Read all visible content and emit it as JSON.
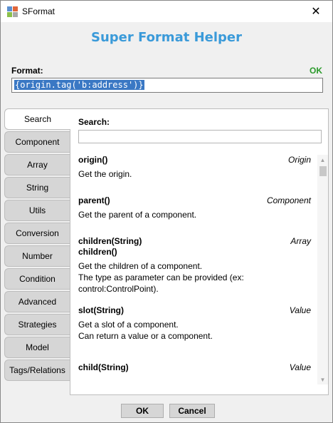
{
  "window": {
    "title": "SFormat",
    "close_glyph": "✕",
    "icon": "app-icon"
  },
  "header": {
    "title": "Super Format Helper"
  },
  "format": {
    "label": "Format:",
    "status": "OK",
    "value": "{origin.tag('b:address')}"
  },
  "tabs": [
    {
      "label": "Search",
      "active": true
    },
    {
      "label": "Component"
    },
    {
      "label": "Array"
    },
    {
      "label": "String"
    },
    {
      "label": "Utils"
    },
    {
      "label": "Conversion"
    },
    {
      "label": "Number"
    },
    {
      "label": "Condition"
    },
    {
      "label": "Advanced"
    },
    {
      "label": "Strategies"
    },
    {
      "label": "Model"
    },
    {
      "label": "Tags/Relations"
    }
  ],
  "search": {
    "label": "Search:",
    "value": ""
  },
  "results": [
    {
      "signatures": [
        "origin()"
      ],
      "type": "Origin",
      "description": [
        "Get the origin."
      ]
    },
    {
      "signatures": [
        "parent()"
      ],
      "type": "Component",
      "description": [
        "Get the parent of a component."
      ]
    },
    {
      "signatures": [
        "children(String)",
        "children()"
      ],
      "type": "Array",
      "description": [
        "Get the children of a component.",
        "The type as parameter can be provided (ex:",
        "control:ControlPoint)."
      ]
    },
    {
      "signatures": [
        "slot(String)"
      ],
      "type": "Value",
      "description": [
        "Get a slot of a component.",
        "Can return a value or a component."
      ]
    },
    {
      "signatures": [
        "child(String)"
      ],
      "type": "Value",
      "description": []
    }
  ],
  "scrollbar": {
    "up_glyph": "▲",
    "down_glyph": "▼"
  },
  "buttons": {
    "ok": "OK",
    "cancel": "Cancel"
  }
}
